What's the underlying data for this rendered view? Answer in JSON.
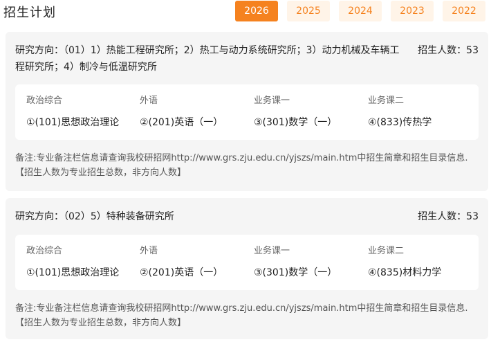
{
  "page": {
    "title": "招生计划"
  },
  "years": [
    {
      "label": "2026",
      "active": true
    },
    {
      "label": "2025",
      "active": false
    },
    {
      "label": "2024",
      "active": false
    },
    {
      "label": "2023",
      "active": false
    },
    {
      "label": "2022",
      "active": false
    }
  ],
  "colors": {
    "accent": "#f5821f",
    "tab_bg": "#fff4e8",
    "card_bg": "#f5f5f5"
  },
  "plans": [
    {
      "direction": "研究方向：（01）1）热能工程研究所；2）热工与动力系统研究所；3）动力机械及车辆工程研究所；4）制冷与低温研究所",
      "quota": "招生人数：53",
      "subjects": [
        {
          "label": "政治综合",
          "value": "①(101)思想政治理论"
        },
        {
          "label": "外语",
          "value": "②(201)英语（一）"
        },
        {
          "label": "业务课一",
          "value": "③(301)数学（一）"
        },
        {
          "label": "业务课二",
          "value": "④(833)传热学"
        }
      ],
      "note": "备注:专业备注栏信息请查询我校研招网http://www.grs.zju.edu.cn/yjszs/main.htm中招生简章和招生目录信息.【招生人数为专业招生总数，非方向人数】"
    },
    {
      "direction": "研究方向：（02）5）特种装备研究所",
      "quota": "招生人数：53",
      "subjects": [
        {
          "label": "政治综合",
          "value": "①(101)思想政治理论"
        },
        {
          "label": "外语",
          "value": "②(201)英语（一）"
        },
        {
          "label": "业务课一",
          "value": "③(301)数学（一）"
        },
        {
          "label": "业务课二",
          "value": "④(835)材料力学"
        }
      ],
      "note": "备注:专业备注栏信息请查询我校研招网http://www.grs.zju.edu.cn/yjszs/main.htm中招生简章和招生目录信息.【招生人数为专业招生总数，非方向人数】"
    }
  ]
}
